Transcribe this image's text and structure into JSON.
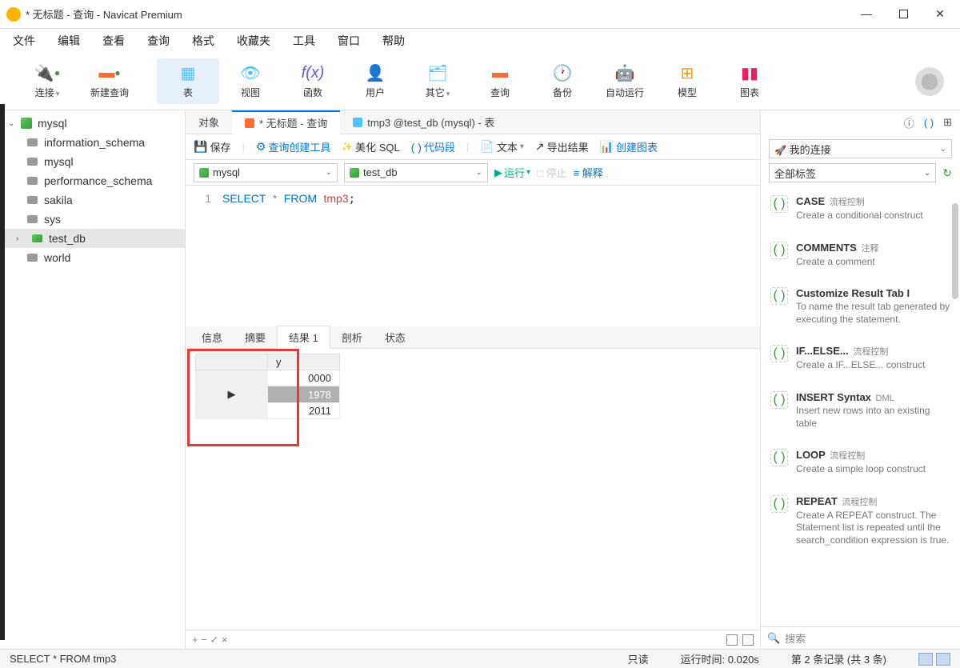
{
  "window": {
    "title": "* 无标题 - 查询 - Navicat Premium"
  },
  "menu": {
    "file": "文件",
    "edit": "编辑",
    "view": "查看",
    "query": "查询",
    "format": "格式",
    "favorites": "收藏夹",
    "tools": "工具",
    "window": "窗口",
    "help": "帮助"
  },
  "toolbar": {
    "connect": "连接",
    "newquery": "新建查询",
    "table": "表",
    "view": "视图",
    "function": "函数",
    "user": "用户",
    "other": "其它",
    "query": "查询",
    "backup": "备份",
    "autorun": "自动运行",
    "model": "模型",
    "chart": "图表"
  },
  "sidebar": {
    "conn": "mysql",
    "dbs": [
      "information_schema",
      "mysql",
      "performance_schema",
      "sakila",
      "sys",
      "test_db",
      "world"
    ],
    "selected": "test_db"
  },
  "tabs": {
    "objects": "对象",
    "query": "* 无标题 - 查询",
    "table": "tmp3 @test_db (mysql) - 表"
  },
  "qtoolbar": {
    "save": "保存",
    "builder": "查询创建工具",
    "beautify": "美化 SQL",
    "snippet": "代码段",
    "text": "文本",
    "export": "导出结果",
    "chart": "创建图表"
  },
  "conn_row": {
    "conn": "mysql",
    "db": "test_db",
    "run": "运行",
    "stop": "停止",
    "explain": "解释"
  },
  "sql": {
    "full": "SELECT * FROM tmp3;",
    "line": "1"
  },
  "result_tabs": {
    "info": "信息",
    "summary": "摘要",
    "result": "结果 1",
    "profile": "剖析",
    "status": "状态"
  },
  "result": {
    "col": "y",
    "rows": [
      "0000",
      "1978",
      "2011"
    ],
    "selected_index": 1
  },
  "result_footer": {
    "ops": "+ − ✓ ×"
  },
  "right": {
    "myconn": "我的连接",
    "alltags": "全部标签",
    "search": "搜索",
    "snippets": [
      {
        "t": "CASE",
        "tag": "流程控制",
        "d": "Create a conditional construct"
      },
      {
        "t": "COMMENTS",
        "tag": "注释",
        "d": "Create a comment"
      },
      {
        "t": "Customize Result Tab I",
        "tag": "",
        "d": "To name the result tab generated by executing the statement."
      },
      {
        "t": "IF...ELSE...",
        "tag": "流程控制",
        "d": "Create a IF...ELSE... construct"
      },
      {
        "t": "INSERT Syntax",
        "tag": "DML",
        "d": "Insert new rows into an existing table"
      },
      {
        "t": "LOOP",
        "tag": "流程控制",
        "d": "Create a simple loop construct"
      },
      {
        "t": "REPEAT",
        "tag": "流程控制",
        "d": "Create A REPEAT construct. The Statement list is repeated until the search_condition expression is true."
      }
    ]
  },
  "status": {
    "sql": "SELECT * FROM tmp3",
    "mode": "只读",
    "time": "运行时间: 0.020s",
    "record": "第 2 条记录 (共 3 条)"
  }
}
